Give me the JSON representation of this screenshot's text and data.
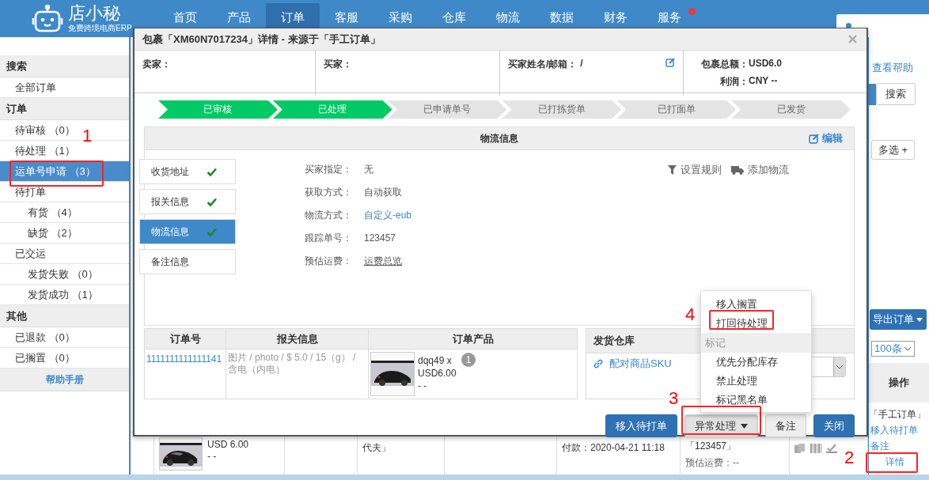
{
  "header": {
    "logo": {
      "name": "店小秘",
      "tagline": "免费跨境电商ERP"
    },
    "nav": [
      {
        "label": "首页",
        "selected": false,
        "notify": false
      },
      {
        "label": "产品",
        "selected": false,
        "notify": false
      },
      {
        "label": "订单",
        "selected": true,
        "notify": false
      },
      {
        "label": "客服",
        "selected": false,
        "notify": false
      },
      {
        "label": "采购",
        "selected": false,
        "notify": false
      },
      {
        "label": "仓库",
        "selected": false,
        "notify": false
      },
      {
        "label": "物流",
        "selected": false,
        "notify": false
      },
      {
        "label": "数据",
        "selected": false,
        "notify": false
      },
      {
        "label": "财务",
        "selected": false,
        "notify": false
      },
      {
        "label": "服务",
        "selected": false,
        "notify": true
      }
    ]
  },
  "sidebar": {
    "sections": [
      {
        "title": "搜索",
        "items": [
          {
            "label": "全部订单",
            "selected": false
          }
        ]
      },
      {
        "title": "订单",
        "items": [
          {
            "label": "待审核",
            "count": "（0）",
            "selected": false
          },
          {
            "label": "待处理",
            "count": "（1）",
            "selected": false
          },
          {
            "label": "运单号申请",
            "count": "（3）",
            "selected": true
          },
          {
            "label": "待打单",
            "selected": false,
            "children": [
              {
                "label": "有货",
                "count": "（4）",
                "selected": false
              },
              {
                "label": "缺货",
                "count": "（2）",
                "selected": false
              }
            ]
          },
          {
            "label": "已交运",
            "selected": false,
            "children": [
              {
                "label": "发货失败",
                "count": "（0）",
                "selected": false
              },
              {
                "label": "发货成功",
                "count": "（1）",
                "selected": false
              }
            ]
          }
        ]
      },
      {
        "title": "其他",
        "items": [
          {
            "label": "已退款",
            "count": "（0）",
            "selected": false
          },
          {
            "label": "已搁置",
            "count": "（0）",
            "selected": false
          }
        ]
      }
    ],
    "help_link": "帮助手册"
  },
  "background": {
    "help_link": "查看帮助",
    "search_button": "搜索",
    "multi_select_button": "多选 +",
    "export_button": "导出订单",
    "page_size": "100条",
    "table": {
      "column": "操作",
      "source": "「手工订单」",
      "actions": [
        "移入待打单",
        "备注",
        "详情"
      ],
      "row": {
        "product_price": "USD 6.00",
        "product_extra": "- -",
        "column_3": "代夫」",
        "payment": "付款：2020-04-21 11:18",
        "tracking": "「123457」",
        "shipping_estimate": "预估运费：--"
      }
    }
  },
  "dialog": {
    "title": "包裹「XM60N7017234」详情 - 来源于「手工订单」",
    "info": {
      "seller_label": "卖家：",
      "buyer_label": "买家：",
      "buyer_name_label": "买家姓名/邮箱：",
      "buyer_name_value": "/",
      "total_label": "包裹总额：",
      "total_value": "USD6.0",
      "profit_label": "利润：",
      "profit_value": "CNY --"
    },
    "steps": [
      {
        "label": "已审核",
        "done": true
      },
      {
        "label": "已处理",
        "done": true
      },
      {
        "label": "已申请单号",
        "done": false
      },
      {
        "label": "已打拣货单",
        "done": false
      },
      {
        "label": "已打面单",
        "done": false
      },
      {
        "label": "已发货",
        "done": false
      }
    ],
    "logistics": {
      "title": "物流信息",
      "edit": "编辑",
      "tabs": [
        {
          "label": "收货地址",
          "selected": false,
          "complete": true
        },
        {
          "label": "报关信息",
          "selected": false,
          "complete": true
        },
        {
          "label": "物流信息",
          "selected": true,
          "complete": true
        },
        {
          "label": "备注信息",
          "selected": false,
          "complete": false
        }
      ],
      "fields": [
        {
          "label": "买家指定：",
          "value": "无",
          "kind": "text"
        },
        {
          "label": "获取方式：",
          "value": "自动获取",
          "kind": "text"
        },
        {
          "label": "物流方式：",
          "value": "自定义-eub",
          "kind": "link"
        },
        {
          "label": "跟踪单号：",
          "value": "123457",
          "kind": "text"
        },
        {
          "label": "预估运费：",
          "value": "运费总览",
          "kind": "underline"
        }
      ],
      "actions": [
        "设置规则",
        "添加物流"
      ]
    },
    "order_table": {
      "columns": [
        "订单号",
        "报关信息",
        "订单产品"
      ],
      "rows": [
        {
          "order_no": "1111111111111141",
          "customs": "图片 / photo / $ 5.0 / 15（g） / 含电（内电）",
          "product_name": "dqq49 x",
          "product_price": "USD6.00",
          "product_extra": "- -",
          "quantity": "1"
        }
      ]
    },
    "warehouse": {
      "title": "发货仓库",
      "link": "配对商品SKU"
    },
    "menu": [
      {
        "label": "移入搁置",
        "kind": "item"
      },
      {
        "label": "打回待处理",
        "kind": "item"
      },
      {
        "label": "标记",
        "kind": "header"
      },
      {
        "label": "优先分配库存",
        "kind": "item"
      },
      {
        "label": "禁止处理",
        "kind": "item"
      },
      {
        "label": "标记黑名单",
        "kind": "item"
      }
    ],
    "buttons": [
      {
        "label": "移入待打单",
        "kind": "primary"
      },
      {
        "label": "异常处理",
        "kind": "dropdown"
      },
      {
        "label": "备注",
        "kind": "default"
      },
      {
        "label": "关闭",
        "kind": "primary"
      }
    ]
  },
  "annotations": [
    {
      "label": "1"
    },
    {
      "label": "4"
    },
    {
      "label": "3"
    },
    {
      "label": "2"
    }
  ]
}
